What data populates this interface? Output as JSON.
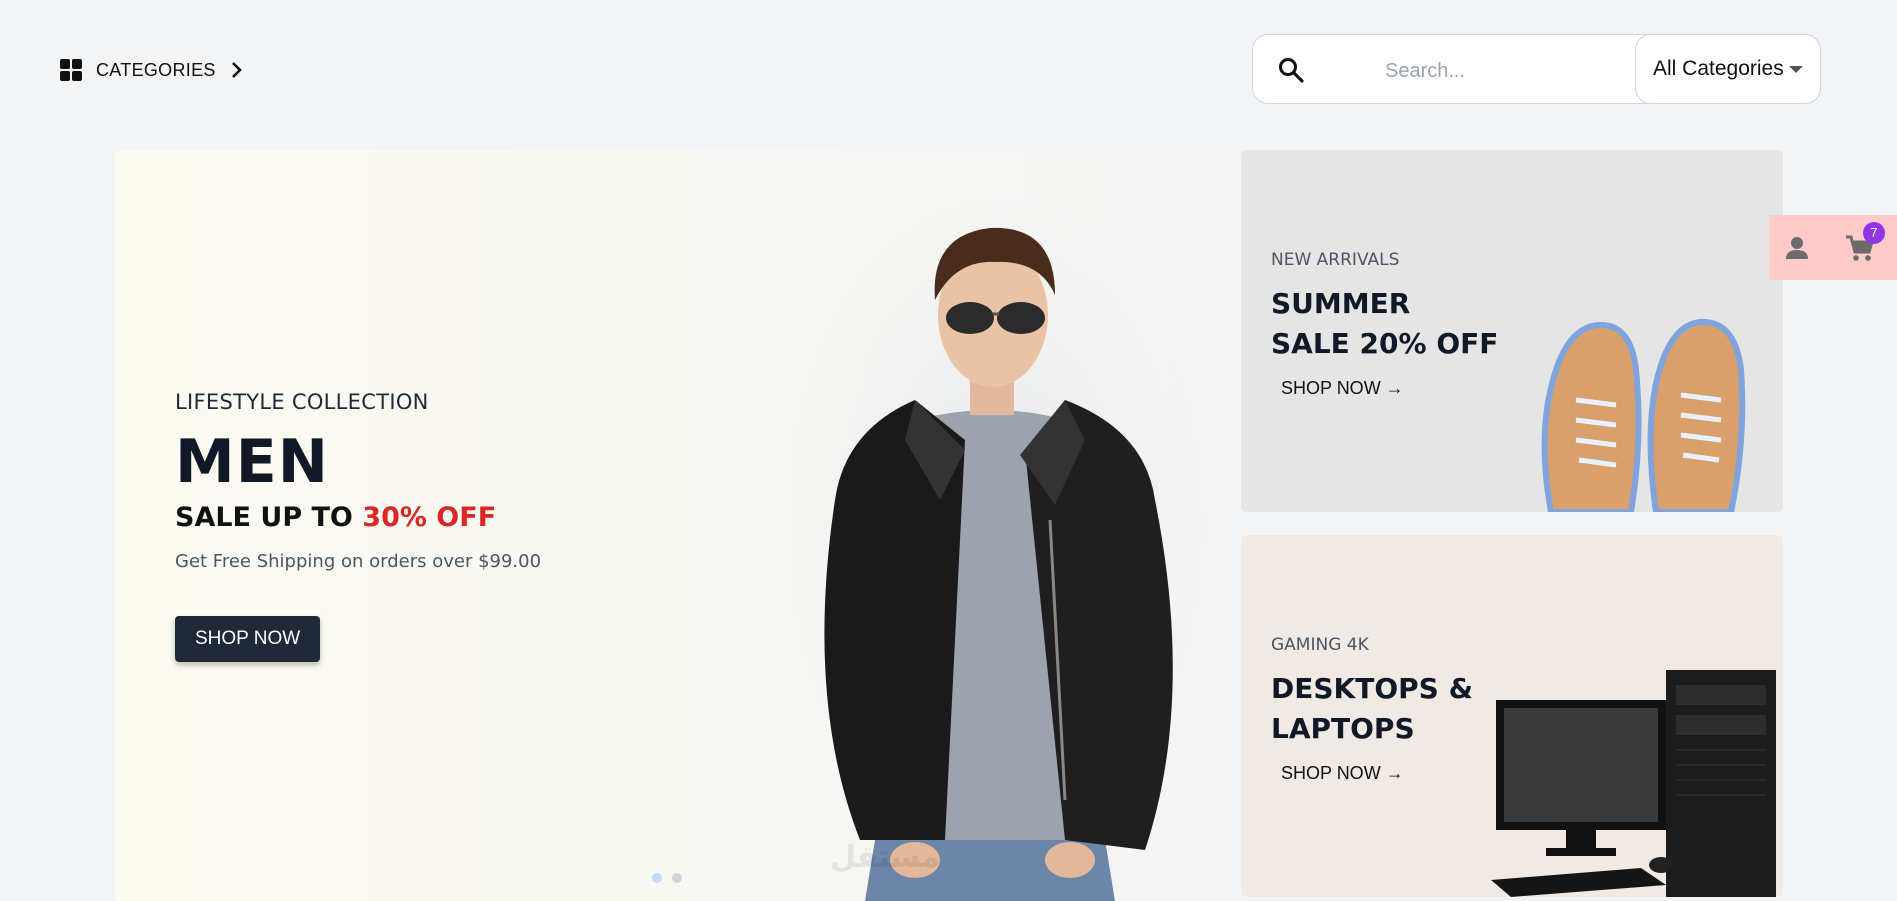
{
  "header": {
    "categories_label": "CATEGORIES",
    "search_placeholder": "Search...",
    "category_select_value": "All Categories"
  },
  "hero": {
    "eyebrow": "LIFESTYLE COLLECTION",
    "title": "MEN",
    "sale_prefix": "SALE UP TO",
    "sale_percent": "30% OFF",
    "shipping": "Get Free Shipping on orders over $99.00",
    "button": "SHOP NOW",
    "slides_total": 2,
    "active_slide": 1
  },
  "promos": [
    {
      "eyebrow": "NEW ARRIVALS",
      "title_line1": "SUMMER",
      "title_line2": "SALE 20% OFF",
      "link": "SHOP NOW →",
      "image": "sneakers"
    },
    {
      "eyebrow": "GAMING 4K",
      "title_line1": "DESKTOPS &",
      "title_line2": "LAPTOPS",
      "link": "SHOP NOW →",
      "image": "desktop-computer"
    }
  ],
  "float_bar": {
    "user_icon": "user-icon",
    "cart_icon": "cart-icon",
    "cart_count": "7"
  },
  "colors": {
    "accent_red": "#dc2626",
    "button_dark": "#1f2937",
    "badge_purple": "#9333ea",
    "float_bar_bg": "#fecaca"
  }
}
